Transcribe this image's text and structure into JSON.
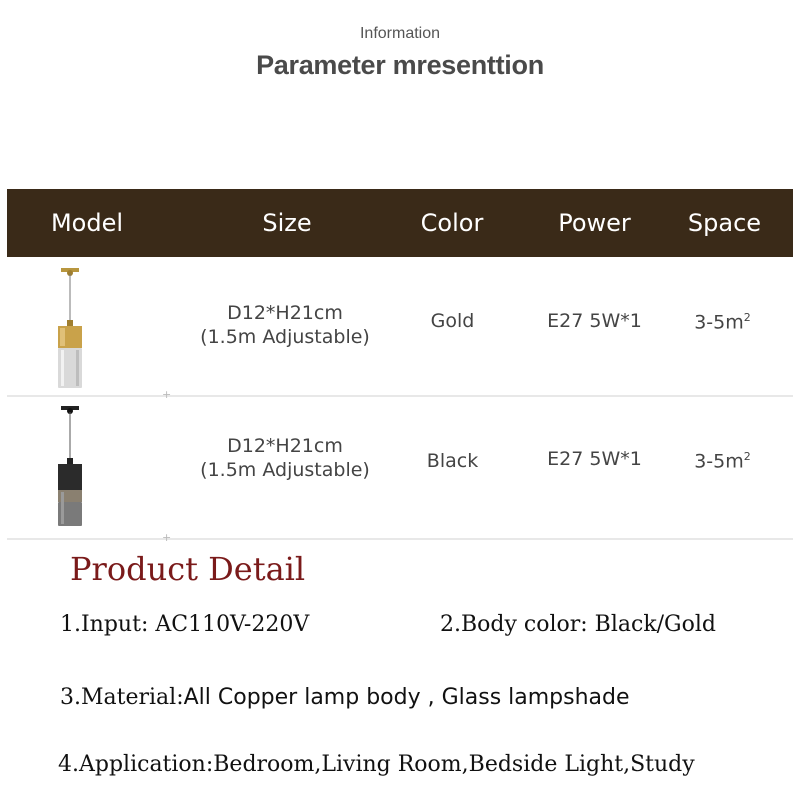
{
  "header": {
    "eyebrow": "Information",
    "title": "Parameter mresenttion"
  },
  "table": {
    "columns": [
      "Model",
      "Size",
      "Color",
      "Power",
      "Space"
    ],
    "rows": [
      {
        "model_icon": "gold-pendant-lamp-icon",
        "size_line1": "D12*H21cm",
        "size_line2": "(1.5m Adjustable)",
        "color": "Gold",
        "power": "E27 5W*1",
        "space": "3-5m",
        "space_unit": "2"
      },
      {
        "model_icon": "black-pendant-lamp-icon",
        "size_line1": "D12*H21cm",
        "size_line2": "(1.5m Adjustable)",
        "color": "Black",
        "power": "E27 5W*1",
        "space": "3-5m",
        "space_unit": "2"
      }
    ],
    "header_bg": "#3a2a18"
  },
  "product_detail": {
    "title": "Product Detail",
    "input": "1.Input: AC110V-220V",
    "body_color": "2.Body color:  Black/Gold",
    "material_label": "3.Material:",
    "material_value": "All Copper lamp body , Glass lampshade",
    "application": "4.Application:Bedroom,Living Room,Bedside Light,Study",
    "title_color": "#7a1a1a"
  }
}
